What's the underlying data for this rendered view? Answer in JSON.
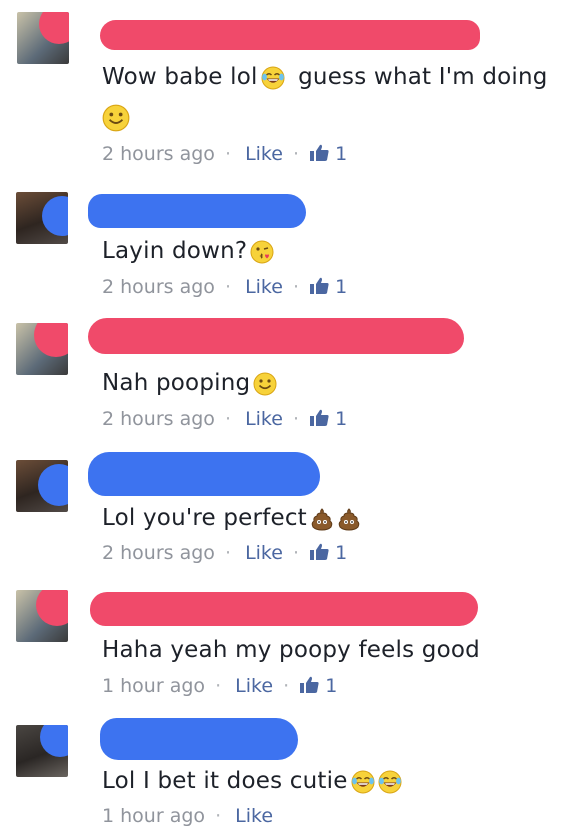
{
  "colors": {
    "female_redact": "#f04a6a",
    "male_redact": "#3d73f0",
    "like": "#4b67a1",
    "meta": "#90949c"
  },
  "comments": [
    {
      "text": "Wow babe lol",
      "text2": "guess what I'm doing",
      "emoji_after_text": "joy-icon",
      "emoji_line": "smile-icon",
      "time": "2 hours ago",
      "like": "Like",
      "count": "1"
    },
    {
      "text": "Layin down?",
      "emoji": "kissing-wink-icon",
      "time": "2 hours ago",
      "like": "Like",
      "count": "1"
    },
    {
      "text": "Nah pooping",
      "emoji": "smile-icon",
      "time": "2 hours ago",
      "like": "Like",
      "count": "1"
    },
    {
      "text": "Lol you're perfect",
      "emoji": "poop-icon",
      "time": "2 hours ago",
      "like": "Like",
      "count": "1"
    },
    {
      "text": "Haha yeah my poopy feels good",
      "time": "1 hour ago",
      "like": "Like",
      "count": "1"
    },
    {
      "text": "Lol I bet it does cutie",
      "emoji": "joy-icon",
      "time": "1 hour ago",
      "like": "Like"
    }
  ]
}
